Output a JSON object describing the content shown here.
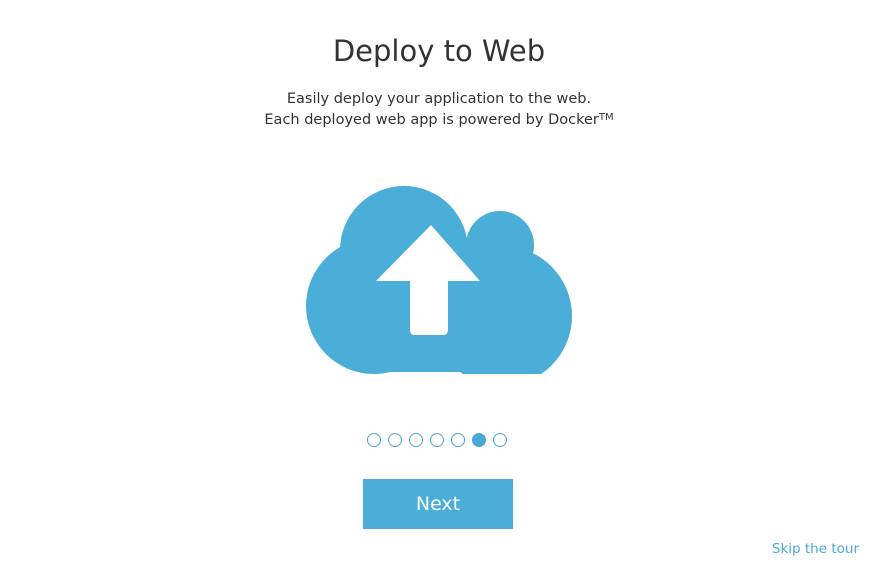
{
  "header": {
    "title": "Deploy to Web"
  },
  "description": {
    "line1": "Easily deploy your application to the web.",
    "line2_text": "Each deployed web app is powered by Docker",
    "line2_sup": "TM"
  },
  "illustration": {
    "icon": "cloud-upload-icon",
    "cloud_color": "#4aaed9",
    "arrow_color": "#ffffff"
  },
  "pagination": {
    "total_steps": 7,
    "current_step": 6,
    "accent_color": "#4aa9d8"
  },
  "actions": {
    "next_label": "Next",
    "skip_label": "Skip the tour",
    "button_color": "#4aaed9"
  }
}
